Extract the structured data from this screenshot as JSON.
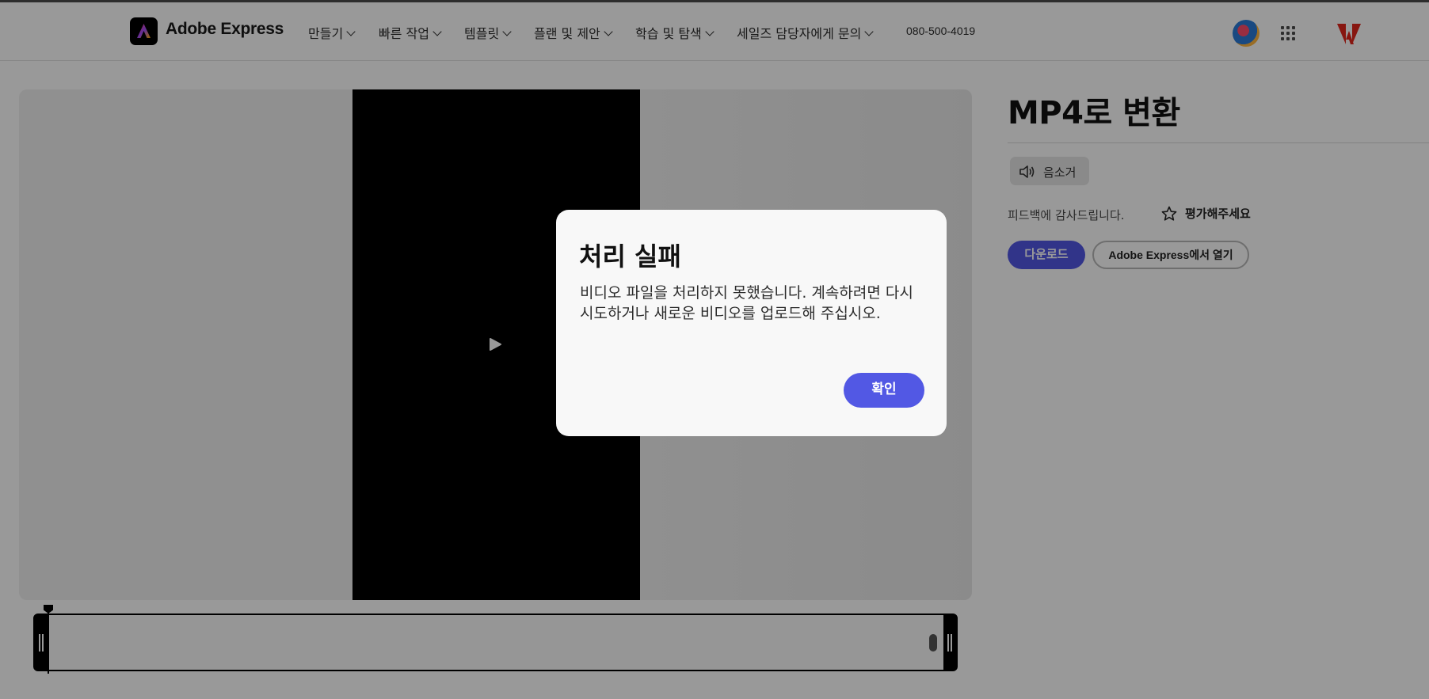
{
  "header": {
    "brand": "Adobe Express",
    "nav": [
      {
        "label": "만들기"
      },
      {
        "label": "빠른 작업"
      },
      {
        "label": "템플릿"
      },
      {
        "label": "플랜 및 제안"
      },
      {
        "label": "학습 및 탐색"
      },
      {
        "label": "세일즈 담당자에게 문의"
      }
    ],
    "phone": "080-500-4019",
    "icons": [
      "avatar",
      "apps-grid-icon",
      "adobe-logo"
    ]
  },
  "side": {
    "title": "MP4로 변환",
    "mute_label": "음소거",
    "feedback_text": "피드백에 감사드립니다.",
    "rate_label": "평가해주세요",
    "download_label": "다운로드",
    "open_label": "Adobe Express에서 열기"
  },
  "dialog": {
    "title": "처리 실패",
    "body": "비디오 파일을 처리하지 못했습니다. 계속하려면 다시 시도하거나 새로운 비디오를 업로드해 주십시오.",
    "ok_label": "확인"
  },
  "colors": {
    "accent": "#5258e4",
    "overlay": "rgba(0,0,0,0.4)"
  }
}
